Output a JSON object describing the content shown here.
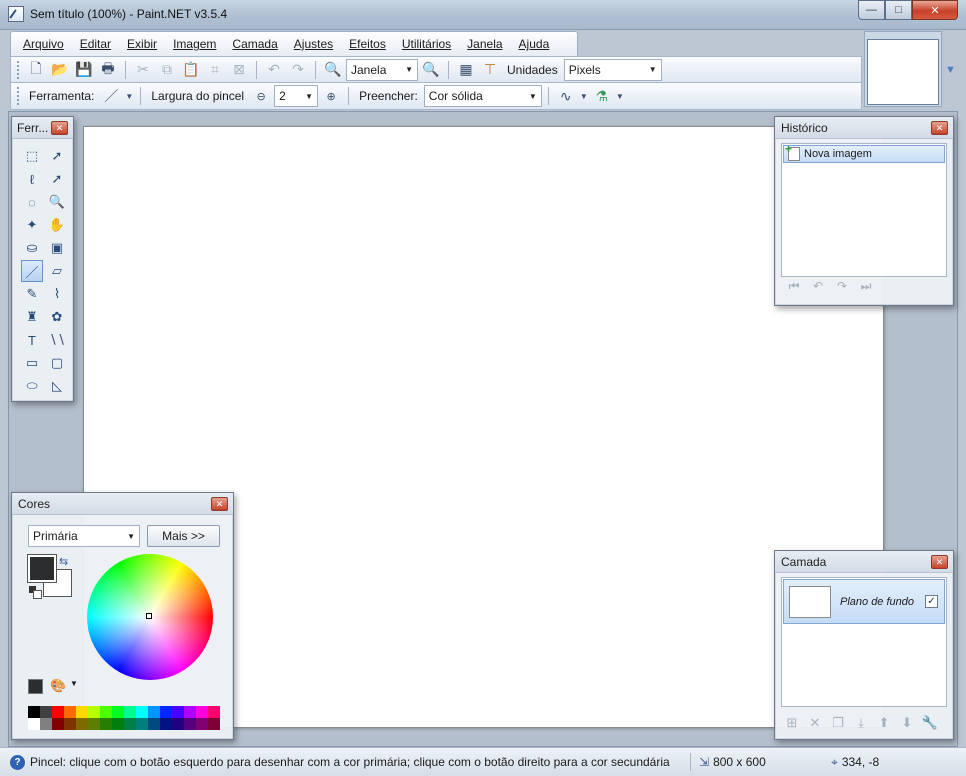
{
  "window": {
    "title": "Sem título (100%) - Paint.NET v3.5.4",
    "controls": {
      "minimize": "—",
      "maximize": "□",
      "close": "✕"
    }
  },
  "menu": [
    "Arquivo",
    "Editar",
    "Exibir",
    "Imagem",
    "Camada",
    "Ajustes",
    "Efeitos",
    "Utilitários",
    "Janela",
    "Ajuda"
  ],
  "toolbar": {
    "zoom_value": "Janela",
    "units_label": "Unidades",
    "units_value": "Pixels"
  },
  "toolbar2": {
    "tool_label": "Ferramenta:",
    "brush_width_label": "Largura do pincel",
    "brush_width_value": "2",
    "fill_label": "Preencher:",
    "fill_value": "Cor sólida"
  },
  "tools_palette": {
    "title": "Ferr...",
    "tools": [
      {
        "name": "rectangle-select",
        "glyph": "⬚"
      },
      {
        "name": "move-selected-pixels",
        "glyph": "➚"
      },
      {
        "name": "lasso-select",
        "glyph": "ℓ"
      },
      {
        "name": "move-selection",
        "glyph": "➚"
      },
      {
        "name": "ellipse-select",
        "glyph": "◌"
      },
      {
        "name": "zoom",
        "glyph": "🔍"
      },
      {
        "name": "magic-wand",
        "glyph": "✦"
      },
      {
        "name": "pan",
        "glyph": "✋"
      },
      {
        "name": "paint-bucket",
        "glyph": "⛀"
      },
      {
        "name": "gradient",
        "glyph": "▣"
      },
      {
        "name": "paintbrush",
        "glyph": "／"
      },
      {
        "name": "eraser",
        "glyph": "▱"
      },
      {
        "name": "pencil",
        "glyph": "✎"
      },
      {
        "name": "color-picker",
        "glyph": "⌇"
      },
      {
        "name": "clone-stamp",
        "glyph": "♜"
      },
      {
        "name": "recolor",
        "glyph": "✿"
      },
      {
        "name": "text",
        "glyph": "T"
      },
      {
        "name": "line-curve",
        "glyph": "∖∖"
      },
      {
        "name": "rectangle",
        "glyph": "▭"
      },
      {
        "name": "rounded-rectangle",
        "glyph": "▢"
      },
      {
        "name": "ellipse",
        "glyph": "⬭"
      },
      {
        "name": "freeform-shape",
        "glyph": "◺"
      }
    ]
  },
  "history": {
    "title": "Histórico",
    "items": [
      "Nova imagem"
    ]
  },
  "colors": {
    "title": "Cores",
    "which_value": "Primária",
    "more_button": "Mais >>",
    "primary_color": "#2b2d2f",
    "secondary_color": "#ffffff",
    "palette_row1": [
      "#000000",
      "#404040",
      "#ff0000",
      "#ff6a00",
      "#ffd800",
      "#b6ff00",
      "#4cff00",
      "#00ff21",
      "#00ff90",
      "#00ffff",
      "#0094ff",
      "#0026ff",
      "#4800ff",
      "#b200ff",
      "#ff00dc",
      "#ff006e"
    ],
    "palette_row2": [
      "#ffffff",
      "#808080",
      "#7f0000",
      "#7f3300",
      "#7f6a00",
      "#5b7f00",
      "#267f00",
      "#007f0e",
      "#007f46",
      "#007f7f",
      "#004a7f",
      "#00137f",
      "#21007f",
      "#57007f",
      "#7f006e",
      "#7f0037"
    ]
  },
  "layers": {
    "title": "Camada",
    "items": [
      {
        "name": "Plano de fundo",
        "visible": "✓"
      }
    ]
  },
  "status": {
    "help_glyph": "?",
    "message": "Pincel: clique com o botão esquerdo para desenhar com a cor primária; clique com o botão direito para a cor secundária",
    "image_size": "800 x 600",
    "cursor_position": "334, -8"
  }
}
